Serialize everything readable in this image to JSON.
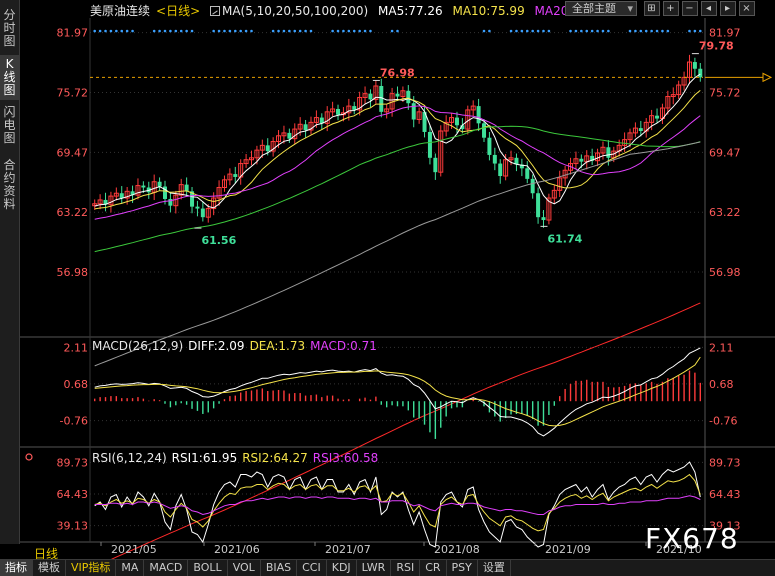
{
  "sidebar": {
    "items": [
      {
        "label": "分时图",
        "active": false
      },
      {
        "label": "K线图",
        "active": true
      },
      {
        "label": "闪电图",
        "active": false
      },
      {
        "label": "合约资料",
        "active": false
      }
    ]
  },
  "header": {
    "symbol": "美原油连续",
    "period": "<日线>",
    "ma_title": "MA(5,10,20,50,100,200)",
    "ma5": "MA5:77.26",
    "ma10": "MA10:75.99",
    "ma20": "MA20"
  },
  "toolbar": {
    "theme": "全部主题",
    "icons": [
      "grid-icon",
      "plus-icon",
      "minus-icon",
      "left-icon",
      "right-icon",
      "close-icon"
    ],
    "glyphs": [
      "⊞",
      "+",
      "−",
      "◂",
      "▸",
      "×"
    ]
  },
  "macd_header": {
    "title": "MACD(26,12,9)",
    "diff": "DIFF:2.09",
    "dea": "DEA:1.73",
    "macd": "MACD:0.71"
  },
  "rsi_header": {
    "title": "RSI(6,12,24)",
    "rsi1": "RSI1:61.95",
    "rsi2": "RSI2:64.27",
    "rsi3": "RSI3:60.58"
  },
  "period_label": "日线",
  "watermark": "FX678",
  "tabs": [
    {
      "label": "指标",
      "active": true
    },
    {
      "label": "模板"
    },
    {
      "label": "VIP指标",
      "vip": true
    },
    {
      "label": "MA"
    },
    {
      "label": "MACD"
    },
    {
      "label": "BOLL"
    },
    {
      "label": "VOL"
    },
    {
      "label": "BIAS"
    },
    {
      "label": "CCI"
    },
    {
      "label": "KDJ"
    },
    {
      "label": "LWR"
    },
    {
      "label": "RSI"
    },
    {
      "label": "CR"
    },
    {
      "label": "PSY"
    },
    {
      "label": "设置"
    }
  ],
  "colors": {
    "up": "#ff3b3b",
    "down": "#3fe09a",
    "ma5": "#ffffff",
    "ma10": "#f4e24a",
    "ma20": "#e040fb",
    "ma50": "#3cc83c",
    "ma100": "#9a9a9a",
    "ma200": "#ff2a2a",
    "axis": "#ff5a5a",
    "grid": "#333333"
  },
  "chart_data": [
    {
      "type": "candlestick",
      "title": "美原油连续 <日线>",
      "x_labels": [
        "2021/05",
        "2021/06",
        "2021/07",
        "2021/08",
        "2021/09",
        "2021/10"
      ],
      "y_ticks": [
        81.97,
        75.72,
        69.47,
        63.22,
        56.98
      ],
      "ylim": [
        50.5,
        83.5
      ],
      "annotations": {
        "high_1": {
          "value": 76.98,
          "label": "76.98"
        },
        "low_1": {
          "value": 61.56,
          "label": "61.56"
        },
        "low_2": {
          "value": 61.74,
          "label": "61.74"
        },
        "high_2": {
          "value": 79.78,
          "label": "79.78"
        },
        "last_price": 77.3
      },
      "close": [
        64.1,
        64.5,
        64.0,
        64.9,
        65.2,
        64.7,
        65.4,
        65.0,
        66.0,
        65.8,
        65.3,
        66.4,
        65.9,
        64.6,
        63.9,
        65.0,
        66.1,
        65.4,
        63.8,
        63.6,
        62.7,
        63.6,
        64.7,
        65.8,
        66.6,
        67.2,
        66.9,
        68.3,
        68.7,
        68.9,
        69.7,
        70.2,
        69.6,
        70.6,
        71.2,
        71.5,
        70.9,
        71.9,
        72.4,
        71.8,
        72.6,
        73.1,
        72.5,
        73.7,
        74.0,
        73.4,
        73.6,
        74.3,
        73.9,
        75.2,
        75.6,
        75.0,
        76.4,
        73.7,
        74.0,
        75.6,
        75.3,
        75.9,
        74.6,
        72.9,
        73.7,
        71.6,
        68.9,
        67.4,
        71.7,
        72.6,
        73.1,
        72.3,
        71.9,
        73.9,
        74.3,
        72.5,
        71.0,
        69.2,
        68.3,
        67.0,
        68.7,
        68.9,
        68.2,
        67.8,
        66.7,
        65.2,
        62.7,
        62.4,
        64.7,
        65.5,
        66.8,
        67.6,
        68.3,
        68.8,
        68.5,
        69.1,
        68.6,
        69.4,
        70.0,
        68.9,
        69.6,
        70.2,
        70.8,
        71.5,
        72.0,
        71.7,
        72.6,
        73.3,
        73.0,
        74.1,
        75.3,
        75.5,
        76.5,
        77.3,
        78.9,
        78.2,
        77.3
      ]
    },
    {
      "type": "macd",
      "title": "MACD(26,12,9)",
      "y_ticks": [
        2.11,
        0.68,
        -0.76
      ],
      "ylim": [
        -1.6,
        2.4
      ],
      "diff": [
        0.55,
        0.6,
        0.62,
        0.66,
        0.68,
        0.66,
        0.67,
        0.69,
        0.72,
        0.7,
        0.66,
        0.7,
        0.68,
        0.6,
        0.5,
        0.52,
        0.55,
        0.5,
        0.38,
        0.3,
        0.18,
        0.16,
        0.2,
        0.28,
        0.38,
        0.46,
        0.5,
        0.6,
        0.68,
        0.74,
        0.82,
        0.9,
        0.9,
        0.96,
        1.02,
        1.06,
        1.04,
        1.08,
        1.12,
        1.1,
        1.14,
        1.18,
        1.15,
        1.2,
        1.22,
        1.18,
        1.16,
        1.18,
        1.14,
        1.2,
        1.24,
        1.2,
        1.28,
        1.1,
        1.02,
        1.04,
        1.0,
        0.98,
        0.86,
        0.65,
        0.55,
        0.32,
        0.02,
        -0.3,
        -0.22,
        -0.1,
        0.0,
        -0.02,
        -0.06,
        0.06,
        0.14,
        0.06,
        -0.06,
        -0.24,
        -0.4,
        -0.6,
        -0.62,
        -0.62,
        -0.68,
        -0.74,
        -0.85,
        -1.0,
        -1.25,
        -1.36,
        -1.22,
        -1.06,
        -0.85,
        -0.66,
        -0.48,
        -0.32,
        -0.22,
        -0.1,
        -0.04,
        0.06,
        0.16,
        0.14,
        0.2,
        0.28,
        0.38,
        0.5,
        0.6,
        0.64,
        0.76,
        0.88,
        0.92,
        1.06,
        1.24,
        1.36,
        1.52,
        1.66,
        1.88,
        1.98,
        2.09
      ],
      "dea": [
        0.5,
        0.52,
        0.54,
        0.56,
        0.58,
        0.6,
        0.61,
        0.63,
        0.64,
        0.65,
        0.65,
        0.66,
        0.66,
        0.65,
        0.62,
        0.6,
        0.59,
        0.57,
        0.53,
        0.49,
        0.43,
        0.38,
        0.34,
        0.33,
        0.34,
        0.36,
        0.39,
        0.43,
        0.48,
        0.53,
        0.59,
        0.65,
        0.7,
        0.75,
        0.8,
        0.85,
        0.89,
        0.92,
        0.96,
        0.99,
        1.02,
        1.05,
        1.07,
        1.09,
        1.11,
        1.13,
        1.13,
        1.14,
        1.14,
        1.15,
        1.17,
        1.17,
        1.19,
        1.17,
        1.14,
        1.12,
        1.1,
        1.08,
        1.04,
        0.97,
        0.89,
        0.78,
        0.63,
        0.44,
        0.3,
        0.2,
        0.14,
        0.1,
        0.06,
        0.06,
        0.07,
        0.07,
        0.04,
        -0.02,
        -0.1,
        -0.2,
        -0.29,
        -0.36,
        -0.43,
        -0.49,
        -0.56,
        -0.65,
        -0.77,
        -0.88,
        -0.95,
        -0.97,
        -0.95,
        -0.9,
        -0.82,
        -0.72,
        -0.62,
        -0.52,
        -0.42,
        -0.32,
        -0.22,
        -0.14,
        -0.07,
        0.0,
        0.08,
        0.16,
        0.25,
        0.33,
        0.41,
        0.5,
        0.58,
        0.68,
        0.79,
        0.9,
        1.02,
        1.14,
        1.28,
        1.42,
        1.73
      ],
      "macd_hist_note": "hist = 2 * (diff - dea)"
    },
    {
      "type": "line",
      "title": "RSI(6,12,24)",
      "y_ticks": [
        89.73,
        64.43,
        39.13
      ],
      "ylim": [
        26,
        98
      ],
      "series": [
        {
          "name": "RSI1",
          "values": [
            55,
            58,
            52,
            62,
            64,
            54,
            62,
            56,
            66,
            62,
            55,
            65,
            58,
            42,
            36,
            55,
            64,
            52,
            34,
            32,
            26,
            40,
            56,
            66,
            72,
            74,
            70,
            80,
            80,
            78,
            82,
            80,
            70,
            78,
            80,
            78,
            68,
            76,
            78,
            68,
            76,
            78,
            68,
            76,
            76,
            66,
            66,
            72,
            64,
            74,
            76,
            66,
            78,
            48,
            52,
            66,
            62,
            66,
            52,
            40,
            50,
            36,
            24,
            22,
            58,
            64,
            66,
            58,
            54,
            68,
            70,
            52,
            42,
            34,
            30,
            26,
            42,
            44,
            38,
            36,
            30,
            26,
            22,
            24,
            48,
            55,
            64,
            68,
            70,
            72,
            66,
            70,
            62,
            68,
            72,
            60,
            66,
            70,
            72,
            76,
            78,
            72,
            78,
            80,
            74,
            80,
            84,
            82,
            84,
            86,
            90,
            82,
            62
          ]
        },
        {
          "name": "RSI2",
          "values": [
            56,
            57,
            55,
            58,
            60,
            57,
            59,
            57,
            61,
            60,
            57,
            60,
            58,
            50,
            46,
            52,
            57,
            53,
            44,
            42,
            38,
            43,
            51,
            57,
            62,
            65,
            64,
            69,
            70,
            70,
            72,
            72,
            68,
            71,
            73,
            72,
            68,
            71,
            72,
            68,
            71,
            72,
            68,
            71,
            71,
            67,
            67,
            69,
            66,
            70,
            71,
            67,
            71,
            58,
            59,
            65,
            63,
            65,
            58,
            50,
            55,
            47,
            40,
            38,
            56,
            60,
            62,
            58,
            56,
            63,
            64,
            56,
            50,
            45,
            42,
            39,
            46,
            47,
            44,
            43,
            40,
            37,
            35,
            36,
            49,
            53,
            58,
            61,
            63,
            64,
            61,
            63,
            60,
            63,
            65,
            59,
            62,
            64,
            66,
            68,
            69,
            67,
            70,
            72,
            69,
            72,
            75,
            74,
            75,
            77,
            80,
            75,
            64
          ]
        },
        {
          "name": "RSI3",
          "values": [
            56,
            56,
            56,
            57,
            57,
            56,
            57,
            56,
            58,
            58,
            57,
            58,
            57,
            55,
            53,
            54,
            55,
            54,
            51,
            50,
            48,
            49,
            51,
            53,
            55,
            56,
            56,
            58,
            59,
            59,
            60,
            61,
            60,
            61,
            62,
            62,
            61,
            62,
            62,
            61,
            62,
            62,
            61,
            62,
            62,
            61,
            61,
            61,
            60,
            61,
            61,
            60,
            61,
            58,
            58,
            59,
            59,
            59,
            57,
            55,
            56,
            54,
            52,
            51,
            55,
            56,
            57,
            56,
            56,
            57,
            57,
            56,
            54,
            53,
            52,
            51,
            52,
            52,
            51,
            51,
            50,
            49,
            48,
            48,
            51,
            52,
            54,
            55,
            55,
            56,
            56,
            56,
            56,
            56,
            57,
            56,
            56,
            57,
            57,
            58,
            58,
            58,
            59,
            59,
            59,
            60,
            61,
            61,
            61,
            62,
            63,
            62,
            60
          ]
        }
      ]
    }
  ]
}
